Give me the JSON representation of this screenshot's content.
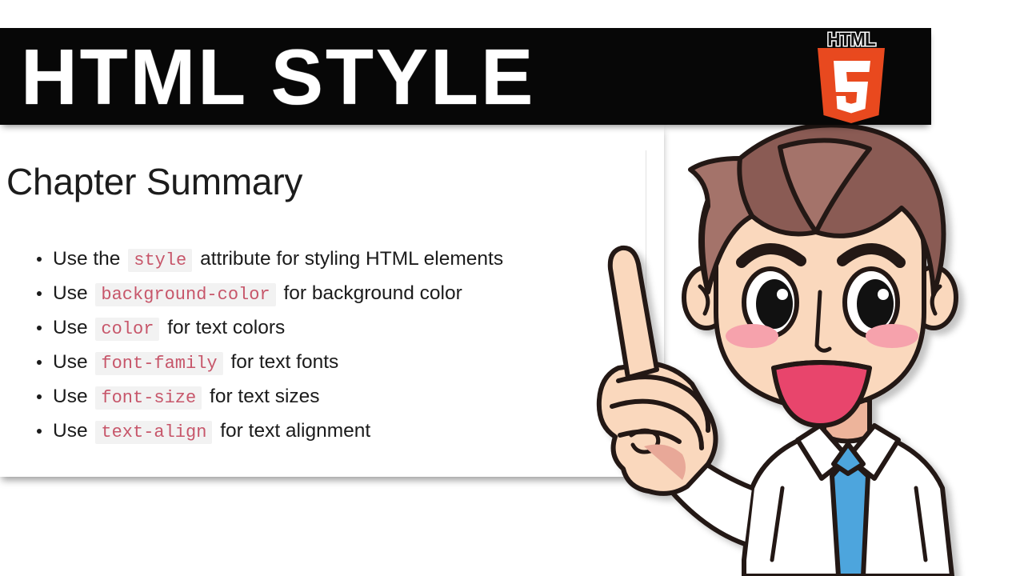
{
  "banner": {
    "title": "HTML STYLE",
    "logo": {
      "word": "HTML",
      "digit": "5",
      "shield_color": "#E8491F",
      "shield_dark": "#F06529"
    },
    "background_color": "#070707",
    "text_color": "#FFFFFF"
  },
  "card": {
    "title": "Chapter Summary",
    "background_color": "#FFFFFF",
    "items": [
      {
        "pre": "Use the",
        "code": "style",
        "post": "attribute for styling HTML elements"
      },
      {
        "pre": "Use",
        "code": "background-color",
        "post": "for background color"
      },
      {
        "pre": "Use",
        "code": "color",
        "post": "for text colors"
      },
      {
        "pre": "Use",
        "code": "font-family",
        "post": "for text fonts"
      },
      {
        "pre": "Use",
        "code": "font-size",
        "post": "for text sizes"
      },
      {
        "pre": "Use",
        "code": "text-align",
        "post": "for text alignment"
      }
    ],
    "code_color": "#C7566A",
    "code_background": "#F2F2F2"
  },
  "character": {
    "description": "cartoon boy pointing up",
    "hair_color": "#8A5B54",
    "hair_shade": "#A4736A",
    "skin_color": "#FAD8BD",
    "cheek_color": "#F6A2AC",
    "mouth_color": "#E8456C",
    "tie_color": "#4DA5DD",
    "shirt_color": "#FFFFFF",
    "outline_color": "#231815"
  }
}
